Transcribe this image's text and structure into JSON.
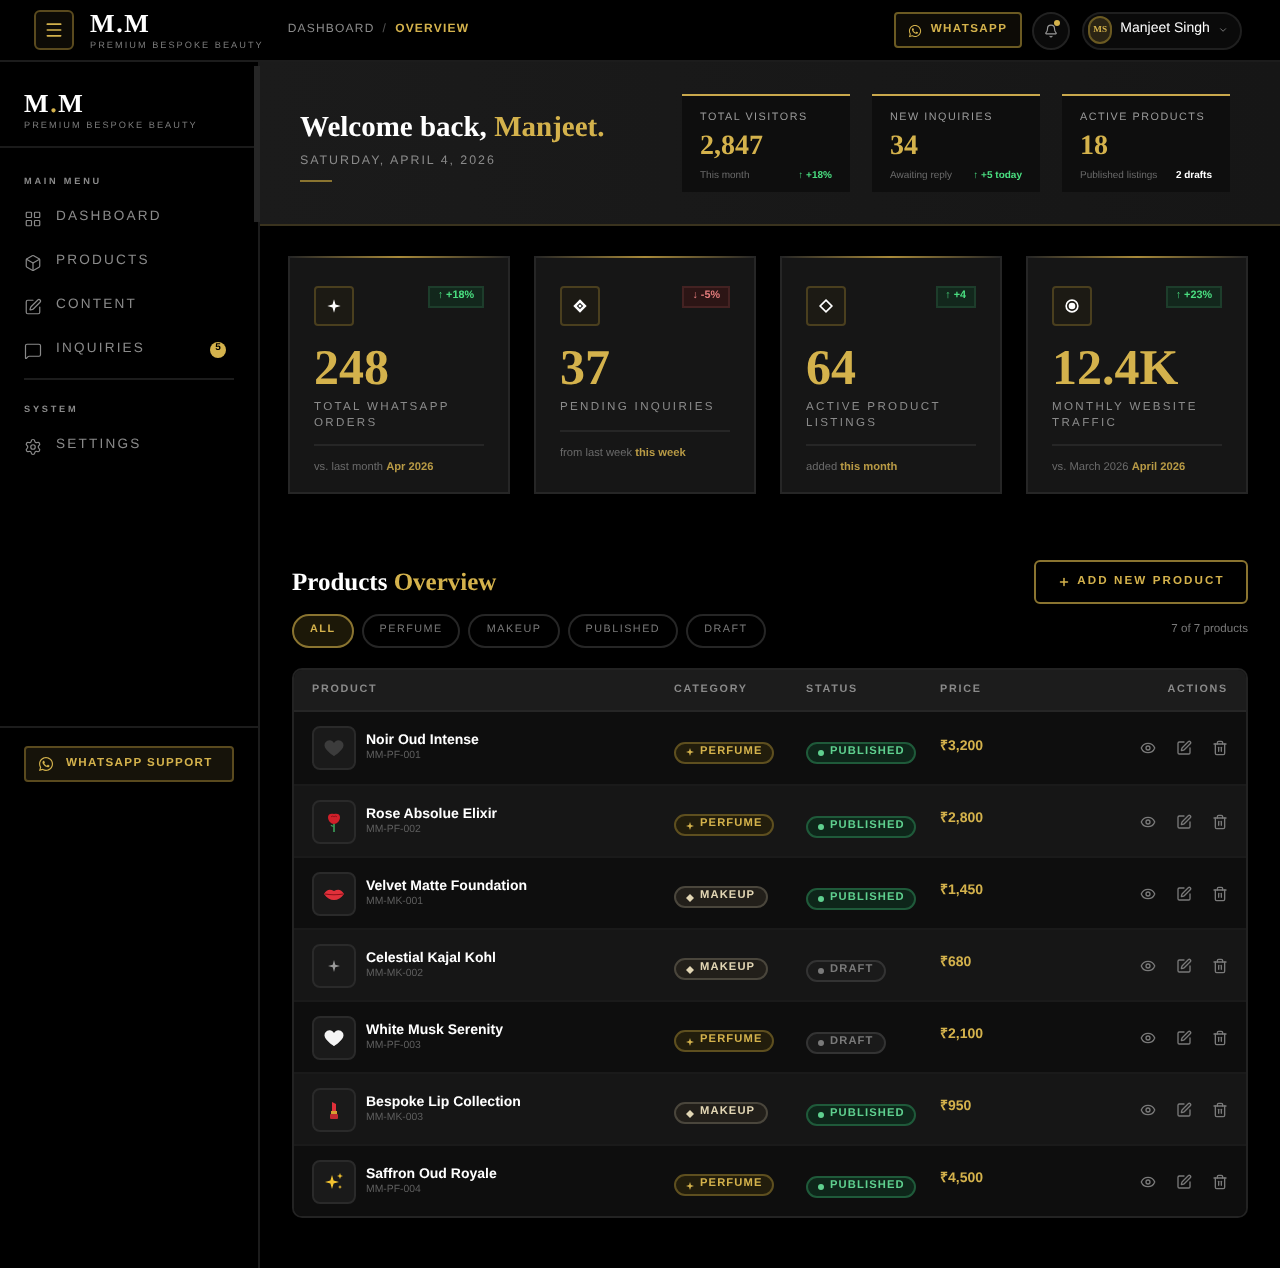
{
  "topbar": {
    "logo": {
      "parts": [
        {
          "text": "M",
          "accent": false
        },
        {
          "text": ".",
          "accent": false
        },
        {
          "text": "M",
          "accent": false
        }
      ],
      "tagline": "PREMIUM BESPOKE BEAUTY"
    },
    "breadcrumb": {
      "items": [
        {
          "label": "DASHBOARD",
          "current": false
        },
        {
          "label": "OVERVIEW",
          "current": true
        }
      ],
      "separator": "/"
    },
    "whatsapp_button": "WHATSAPP",
    "notifications": {
      "unread": true
    },
    "user": {
      "initials": "MS",
      "name": "Manjeet Singh"
    }
  },
  "sidebar": {
    "logo": {
      "parts": [
        {
          "text": "M",
          "accent": false
        },
        {
          "text": ".",
          "accent": true
        },
        {
          "text": "M",
          "accent": false
        }
      ],
      "tagline": "PREMIUM BESPOKE BEAUTY"
    },
    "sections": [
      {
        "title": "MAIN MENU",
        "items": [
          {
            "label": "DASHBOARD"
          },
          {
            "label": "PRODUCTS"
          },
          {
            "label": "CONTENT"
          },
          {
            "label": "INQUIRIES",
            "badge": "5"
          }
        ]
      },
      {
        "title": "SYSTEM",
        "items": [
          {
            "label": "SETTINGS"
          }
        ]
      }
    ],
    "support_button": "WHATSAPP SUPPORT"
  },
  "hero": {
    "greeting": "Welcome back,",
    "name": "Manjeet.",
    "date": "SATURDAY, APRIL 4, 2026",
    "metrics": [
      {
        "label": "TOTAL VISITORS",
        "value": "2,847",
        "note": "This month",
        "change": "↑ +18%",
        "kind": "up"
      },
      {
        "label": "NEW INQUIRIES",
        "value": "34",
        "note": "Awaiting reply",
        "change": "↑ +5 today",
        "kind": "up"
      },
      {
        "label": "ACTIVE PRODUCTS",
        "value": "18",
        "note": "Published listings",
        "change": "2 drafts",
        "kind": "neutral"
      }
    ]
  },
  "stat_cards": [
    {
      "change": "↑ +18%",
      "kind": "up",
      "value": "248",
      "label": "TOTAL WHATSAPP ORDERS",
      "footnote": "vs. last month",
      "footnote_highlight": "Apr 2026"
    },
    {
      "change": "↓ -5%",
      "kind": "down",
      "value": "37",
      "label": "PENDING INQUIRIES",
      "footnote": "from last week",
      "footnote_highlight": "this week"
    },
    {
      "change": "↑ +4",
      "kind": "up",
      "value": "64",
      "label": "ACTIVE PRODUCT LISTINGS",
      "footnote": "added",
      "footnote_highlight": "this month"
    },
    {
      "change": "↑ +23%",
      "kind": "up",
      "value": "12.4K",
      "label": "MONTHLY WEBSITE TRAFFIC",
      "footnote": "vs. March 2026",
      "footnote_highlight": "April 2026"
    }
  ],
  "products": {
    "title": "Products",
    "title_accent": "Overview",
    "add_button": "ADD NEW PRODUCT",
    "filters": [
      {
        "label": "ALL",
        "selected": true
      },
      {
        "label": "PERFUME",
        "selected": false
      },
      {
        "label": "MAKEUP",
        "selected": false
      },
      {
        "label": "PUBLISHED",
        "selected": false
      },
      {
        "label": "DRAFT",
        "selected": false
      }
    ],
    "count": "7 of 7 products",
    "table": {
      "columns": [
        "PRODUCT",
        "CATEGORY",
        "STATUS",
        "PRICE",
        "ACTIONS"
      ],
      "rows": [
        {
          "name": "Noir Oud Intense",
          "sku": "MM-PF-001",
          "category": {
            "label": "PERFUME",
            "kind": "perfume"
          },
          "status": {
            "label": "PUBLISHED",
            "kind": "published"
          },
          "price": "₹3,200"
        },
        {
          "name": "Rose Absolue Elixir",
          "sku": "MM-PF-002",
          "category": {
            "label": "PERFUME",
            "kind": "perfume"
          },
          "status": {
            "label": "PUBLISHED",
            "kind": "published"
          },
          "price": "₹2,800"
        },
        {
          "name": "Velvet Matte Foundation",
          "sku": "MM-MK-001",
          "category": {
            "label": "MAKEUP",
            "kind": "makeup"
          },
          "status": {
            "label": "PUBLISHED",
            "kind": "published"
          },
          "price": "₹1,450"
        },
        {
          "name": "Celestial Kajal Kohl",
          "sku": "MM-MK-002",
          "category": {
            "label": "MAKEUP",
            "kind": "makeup"
          },
          "status": {
            "label": "DRAFT",
            "kind": "draft"
          },
          "price": "₹680"
        },
        {
          "name": "White Musk Serenity",
          "sku": "MM-PF-003",
          "category": {
            "label": "PERFUME",
            "kind": "perfume"
          },
          "status": {
            "label": "DRAFT",
            "kind": "draft"
          },
          "price": "₹2,100"
        },
        {
          "name": "Bespoke Lip Collection",
          "sku": "MM-MK-003",
          "category": {
            "label": "MAKEUP",
            "kind": "makeup"
          },
          "status": {
            "label": "PUBLISHED",
            "kind": "published"
          },
          "price": "₹950"
        },
        {
          "name": "Saffron Oud Royale",
          "sku": "MM-PF-004",
          "category": {
            "label": "PERFUME",
            "kind": "perfume"
          },
          "status": {
            "label": "PUBLISHED",
            "kind": "published"
          },
          "price": "₹4,500"
        }
      ]
    }
  }
}
